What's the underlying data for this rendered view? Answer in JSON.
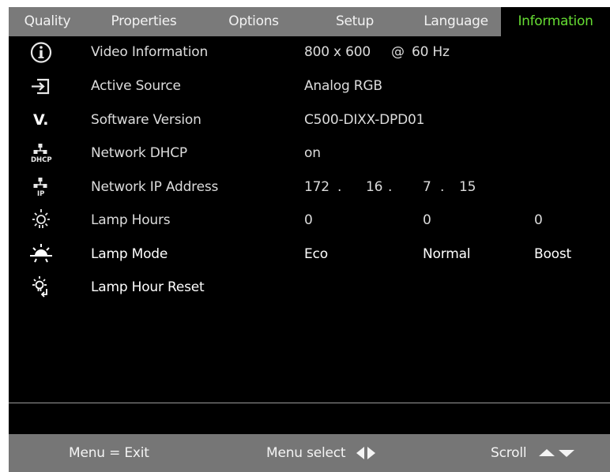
{
  "tabs": [
    {
      "label": "Quality",
      "active": false
    },
    {
      "label": "Properties",
      "active": false
    },
    {
      "label": "Options",
      "active": false
    },
    {
      "label": "Setup",
      "active": false
    },
    {
      "label": "Language",
      "active": false
    },
    {
      "label": "Information",
      "active": true
    }
  ],
  "colors": {
    "active_tab_text": "#66dd33",
    "tab_bar": "#7a7a7a",
    "background": "#000000",
    "footer": "#767676"
  },
  "rows": [
    {
      "icon": "info-icon",
      "label": "Video Information",
      "value_res": "800 x 600",
      "value_at": "@",
      "value_hz": "60 Hz"
    },
    {
      "icon": "input-source-icon",
      "label": "Active Source",
      "value": "Analog RGB"
    },
    {
      "icon": "version-icon",
      "label": "Software Version",
      "value": "C500-DIXX-DPD01"
    },
    {
      "icon": "network-dhcp-icon",
      "label": "Network DHCP",
      "value": "on"
    },
    {
      "icon": "network-ip-icon",
      "label": "Network IP Address",
      "ip": [
        "172",
        "16",
        "7",
        "15"
      ]
    },
    {
      "icon": "lamp-hours-icon",
      "label": "Lamp Hours",
      "values": [
        "0",
        "0",
        "0"
      ]
    },
    {
      "icon": "lamp-mode-icon",
      "label": "Lamp Mode",
      "options": [
        "Eco",
        "Normal",
        "Boost"
      ]
    },
    {
      "icon": "lamp-reset-icon",
      "label": "Lamp Hour Reset"
    }
  ],
  "icon_glyphs": {
    "version": "V.",
    "dhcp": "DHCP",
    "ip": "IP"
  },
  "footer": {
    "exit": "Menu = Exit",
    "select": "Menu select",
    "scroll": "Scroll"
  }
}
